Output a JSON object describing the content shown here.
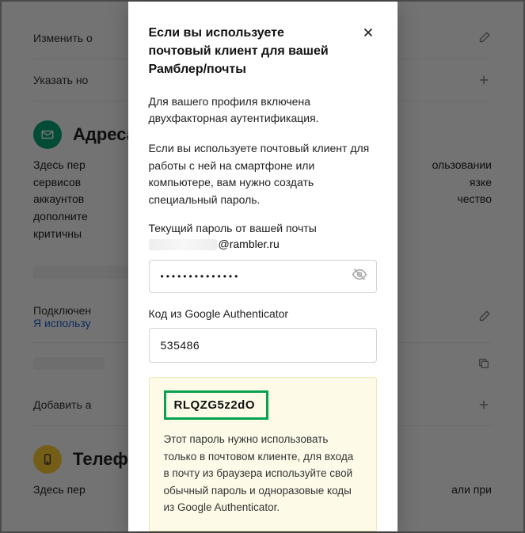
{
  "bg": {
    "row1": "Изменить о",
    "row2": "Указать но",
    "section1_title": "Адреса",
    "section1_desc_l1": "Здесь пер",
    "section1_desc_l2": "сервисов",
    "section1_desc_l3": "аккаунтов",
    "section1_desc_l4": "дополните",
    "section1_desc_l5": "критичны",
    "section1_desc_r1": "ользовании",
    "section1_desc_r2": "язке",
    "section1_desc_r3": "чество",
    "connected": "Подключен",
    "use_link": "Я использу",
    "add": "Добавить а",
    "section2_title": "Телефо",
    "section2_desc_l": "Здесь пер",
    "section2_desc_r": "али при"
  },
  "modal": {
    "title": "Если вы используете почтовый клиент для вашей Рамблер/почты",
    "p1": "Для вашего профиля включена двухфакторная аутентификация.",
    "p2": "Если вы используете почтовый клиент для работы с ней на смартфоне или компьютере, вам нужно создать специальный пароль.",
    "current_pw_label": "Текущий пароль от вашей почты",
    "email_domain": "@rambler.ru",
    "password_masked": "••••••••••••••",
    "code_label": "Код из Google Authenticator",
    "code_value": "535486",
    "generated_password": "RLQZG5z2dO",
    "note": "Этот пароль нужно использовать только в почтовом клиенте, для входа в почту из браузера используйте свой обычный пароль и одноразовые коды из Google Authenticator."
  }
}
